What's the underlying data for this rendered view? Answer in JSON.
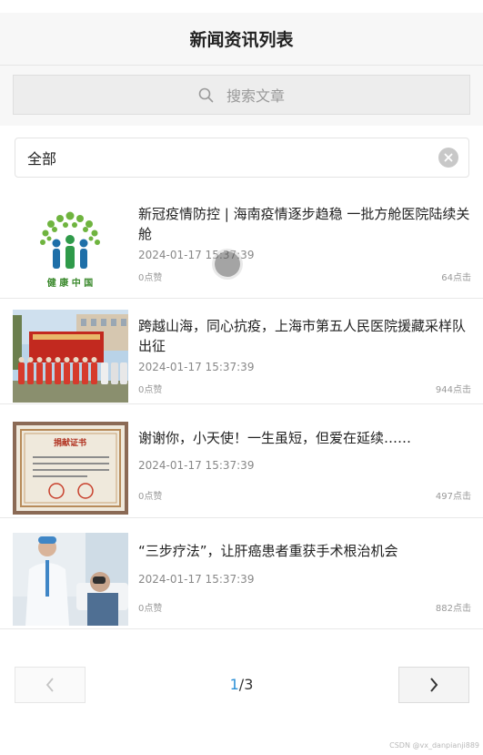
{
  "header": {
    "title": "新闻资讯列表"
  },
  "search": {
    "placeholder": "搜索文章",
    "icon": "search-icon"
  },
  "filter": {
    "selected": "全部",
    "clear_icon": "clear-icon"
  },
  "news": [
    {
      "title": "新冠疫情防控 | 海南疫情逐步趋稳 一批方舱医院陆续关舱",
      "date": "2024-01-17 15:37:39",
      "likes": "0点赞",
      "views": "64点击",
      "logo_text": "健 康 中 国"
    },
    {
      "title": "跨越山海，同心抗疫，上海市第五人民医院援藏采样队出征",
      "date": "2024-01-17 15:37:39",
      "likes": "0点赞",
      "views": "944点击"
    },
    {
      "title": "谢谢你，小天使！一生虽短，但爱在延续……",
      "date": "2024-01-17 15:37:39",
      "likes": "0点赞",
      "views": "497点击",
      "certificate_title": "捐献证书"
    },
    {
      "title": "“三步疗法”，让肝癌患者重获手术根治机会",
      "date": "2024-01-17 15:37:39",
      "likes": "0点赞",
      "views": "882点击"
    }
  ],
  "pagination": {
    "current": "1",
    "separator": "/",
    "total": "3"
  },
  "watermark": "CSDN @vx_danpianji889",
  "colors": {
    "accent": "#2b8fd6",
    "header_bg": "#f7f7f7",
    "search_bg": "#ededed"
  }
}
